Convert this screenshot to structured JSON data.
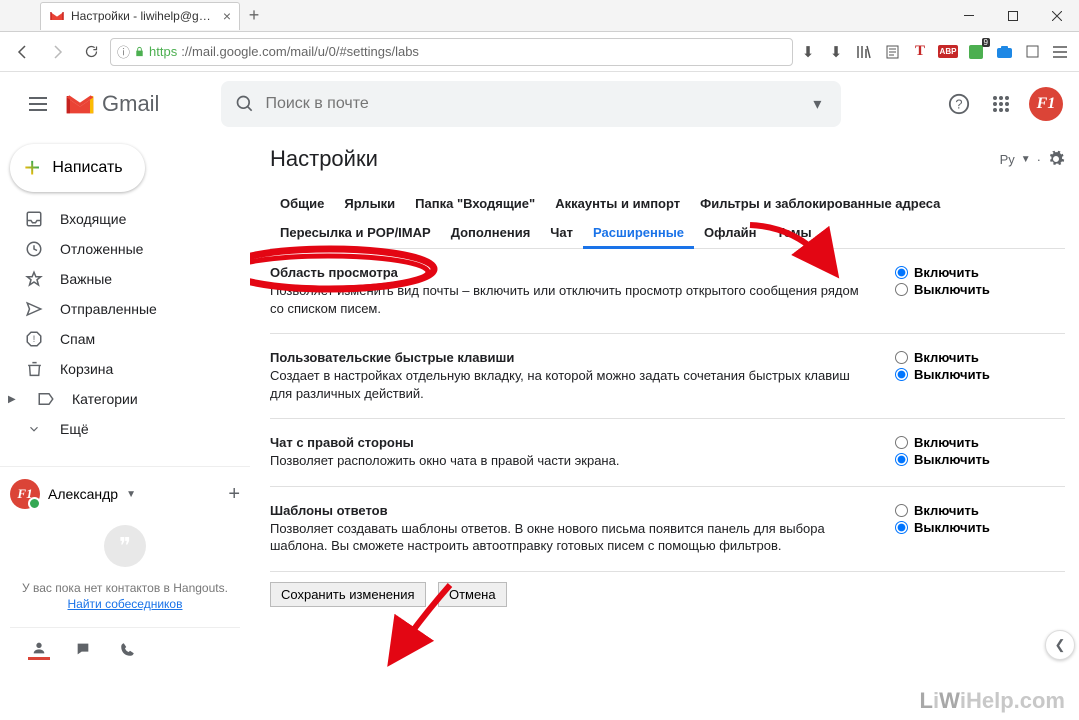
{
  "browser": {
    "tab_title": "Настройки - liwihelp@gmail.c",
    "url_protocol": "https",
    "url_rest": "://mail.google.com/mail/u/0/#settings/labs",
    "badge_n": "9"
  },
  "header": {
    "logo_text": "Gmail",
    "search_placeholder": "Поиск в почте",
    "avatar_text": "F1"
  },
  "sidebar": {
    "compose": "Написать",
    "folders": [
      {
        "icon": "inbox",
        "label": "Входящие"
      },
      {
        "icon": "clock",
        "label": "Отложенные"
      },
      {
        "icon": "star",
        "label": "Важные"
      },
      {
        "icon": "send",
        "label": "Отправленные"
      },
      {
        "icon": "spam",
        "label": "Спам"
      },
      {
        "icon": "trash",
        "label": "Корзина"
      },
      {
        "icon": "label",
        "label": "Категории",
        "arrow": true
      },
      {
        "icon": "more",
        "label": "Ещё"
      }
    ]
  },
  "hangouts": {
    "user": "Александр",
    "empty_text": "У вас пока нет контактов в Hangouts.",
    "link": "Найти собеседников",
    "avatar_text": "F1"
  },
  "content": {
    "title": "Настройки",
    "lang": "Py",
    "tabs_row1": [
      "Общие",
      "Ярлыки",
      "Папка \"Входящие\"",
      "Аккаунты и импорт",
      "Фильтры и заблокированные адреса"
    ],
    "tabs_row2": [
      "Пересылка и POP/IMAP",
      "Дополнения",
      "Чат",
      "Расширенные",
      "Офлайн",
      "Темы"
    ],
    "active_tab": "Расширенные",
    "sections": [
      {
        "title": "Область просмотра",
        "desc": "Позволяет изменить вид почты – включить или отключить просмотр открытого сообщения рядом со списком писем.",
        "enable": "Включить",
        "disable": "Выключить",
        "checked": "enable"
      },
      {
        "title": "Пользовательские быстрые клавиши",
        "desc": "Создает в настройках отдельную вкладку, на которой можно задать сочетания быстрых клавиш для различных действий.",
        "enable": "Включить",
        "disable": "Выключить",
        "checked": "disable"
      },
      {
        "title": "Чат с правой стороны",
        "desc": "Позволяет расположить окно чата в правой части экрана.",
        "enable": "Включить",
        "disable": "Выключить",
        "checked": "disable"
      },
      {
        "title": "Шаблоны ответов",
        "desc": "Позволяет создавать шаблоны ответов. В окне нового письма появится панель для выбора шаблона. Вы сможете настроить автоотправку готовых писем с помощью фильтров.",
        "enable": "Включить",
        "disable": "Выключить",
        "checked": "disable"
      }
    ],
    "save": "Сохранить изменения",
    "cancel": "Отмена"
  },
  "watermark": {
    "a": "L",
    "b": "i",
    "c": "W",
    "d": "i",
    "e": "Help",
    "f": ".com"
  }
}
